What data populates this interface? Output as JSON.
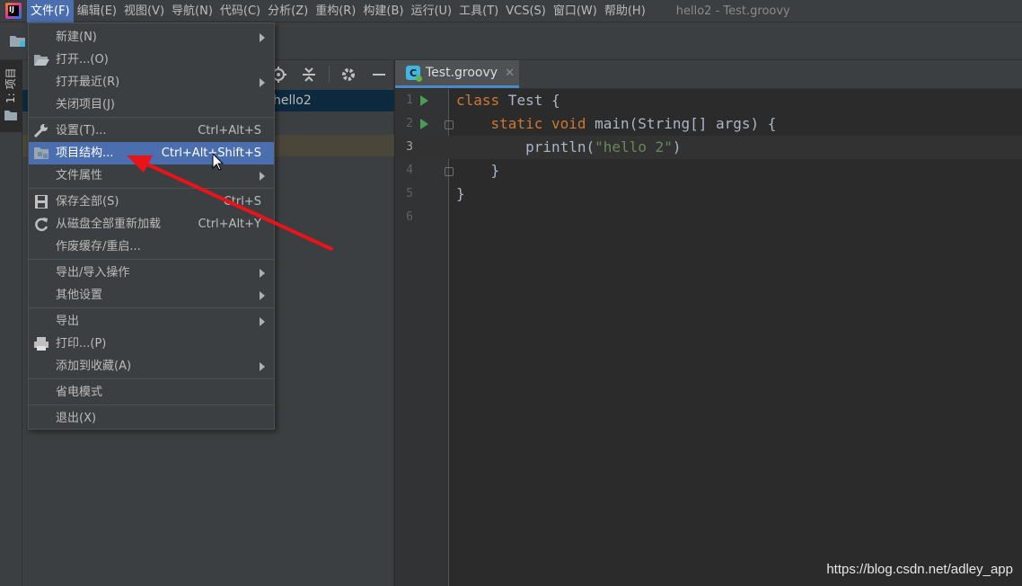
{
  "app": {
    "logo_text": "IJ",
    "window_title": "hello2 - Test.groovy"
  },
  "menubar": {
    "items": [
      "文件(F)",
      "编辑(E)",
      "视图(V)",
      "导航(N)",
      "代码(C)",
      "分析(Z)",
      "重构(R)",
      "构建(B)",
      "运行(U)",
      "工具(T)",
      "VCS(S)",
      "窗口(W)",
      "帮助(H)"
    ],
    "active_index": 0
  },
  "left_strip": {
    "tab_label": "1: 项目"
  },
  "project_panel": {
    "tree_root_text": "hello2"
  },
  "file_menu": {
    "items": [
      {
        "label": "新建(N)",
        "shortcut": "",
        "submenu": true,
        "icon": ""
      },
      {
        "label": "打开...(O)",
        "shortcut": "",
        "submenu": false,
        "icon": "folder-open-icon"
      },
      {
        "label": "打开最近(R)",
        "shortcut": "",
        "submenu": true,
        "icon": ""
      },
      {
        "label": "关闭项目(J)",
        "shortcut": "",
        "submenu": false,
        "icon": ""
      },
      {
        "label": "设置(T)...",
        "shortcut": "Ctrl+Alt+S",
        "submenu": false,
        "icon": "wrench-icon"
      },
      {
        "label": "项目结构...",
        "shortcut": "Ctrl+Alt+Shift+S",
        "submenu": false,
        "icon": "project-structure-icon",
        "selected": true
      },
      {
        "label": "文件属性",
        "shortcut": "",
        "submenu": true,
        "icon": ""
      },
      {
        "label": "保存全部(S)",
        "shortcut": "Ctrl+S",
        "submenu": false,
        "icon": "save-icon"
      },
      {
        "label": "从磁盘全部重新加载",
        "shortcut": "Ctrl+Alt+Y",
        "submenu": false,
        "icon": "reload-icon"
      },
      {
        "label": "作废缓存/重启...",
        "shortcut": "",
        "submenu": false,
        "icon": ""
      },
      {
        "label": "导出/导入操作",
        "shortcut": "",
        "submenu": true,
        "icon": ""
      },
      {
        "label": "其他设置",
        "shortcut": "",
        "submenu": true,
        "icon": ""
      },
      {
        "label": "导出",
        "shortcut": "",
        "submenu": true,
        "icon": ""
      },
      {
        "label": "打印...(P)",
        "shortcut": "",
        "submenu": false,
        "icon": "print-icon"
      },
      {
        "label": "添加到收藏(A)",
        "shortcut": "",
        "submenu": true,
        "icon": ""
      },
      {
        "label": "省电模式",
        "shortcut": "",
        "submenu": false,
        "icon": ""
      },
      {
        "label": "退出(X)",
        "shortcut": "",
        "submenu": false,
        "icon": ""
      }
    ]
  },
  "editor": {
    "tab": {
      "label": "Test.groovy",
      "icon": "groovy-file-icon",
      "close": "✕"
    },
    "current_line": 3,
    "line_numbers": [
      "1",
      "2",
      "3",
      "4",
      "5",
      "6"
    ],
    "code": {
      "l1_kw": "class",
      "l1_rest": " Test {",
      "l2_indent": "    ",
      "l2_kw1": "static",
      "l2_sp": " ",
      "l2_kw2": "void",
      "l2_rest": " main(String[] args) {",
      "l3_pre": "        println(",
      "l3_str": "\"hello 2\"",
      "l3_post": ")",
      "l4": "    }",
      "l5": "}",
      "l6": ""
    }
  },
  "watermark": "https://blog.csdn.net/adley_app",
  "colors": {
    "accent": "#4b6eaf",
    "annotation_arrow": "#e8141a",
    "keyword": "#cc7832",
    "string": "#6a8759"
  }
}
